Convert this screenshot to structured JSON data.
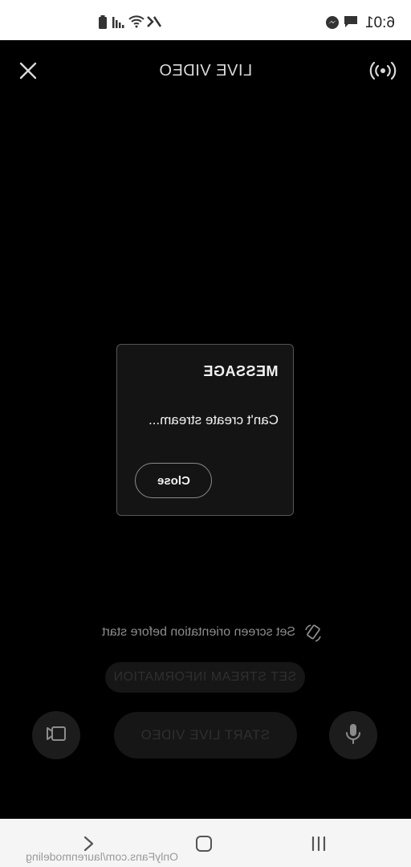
{
  "status_bar": {
    "time": "6:01"
  },
  "header": {
    "title": "LIVE VIDEO"
  },
  "dialog": {
    "title": "MESSAGE",
    "message": "Can't create stream...",
    "close_label": "Close"
  },
  "orientation_hint": "Set screen orientation before start",
  "buttons": {
    "set_stream_info": "SET STREAM INFORMATION",
    "start_live_video": "START LIVE VIDEO"
  },
  "watermark": "OnlyFans.com/laurenmodeling",
  "icons": {
    "close": "close-icon",
    "broadcast": "broadcast-icon",
    "orientation": "rotate-icon",
    "camera_switch": "camera-switch-icon",
    "microphone": "microphone-icon"
  },
  "colors": {
    "background": "#000000",
    "text_primary": "#f2f2f2",
    "text_muted": "#8c8c8c"
  }
}
